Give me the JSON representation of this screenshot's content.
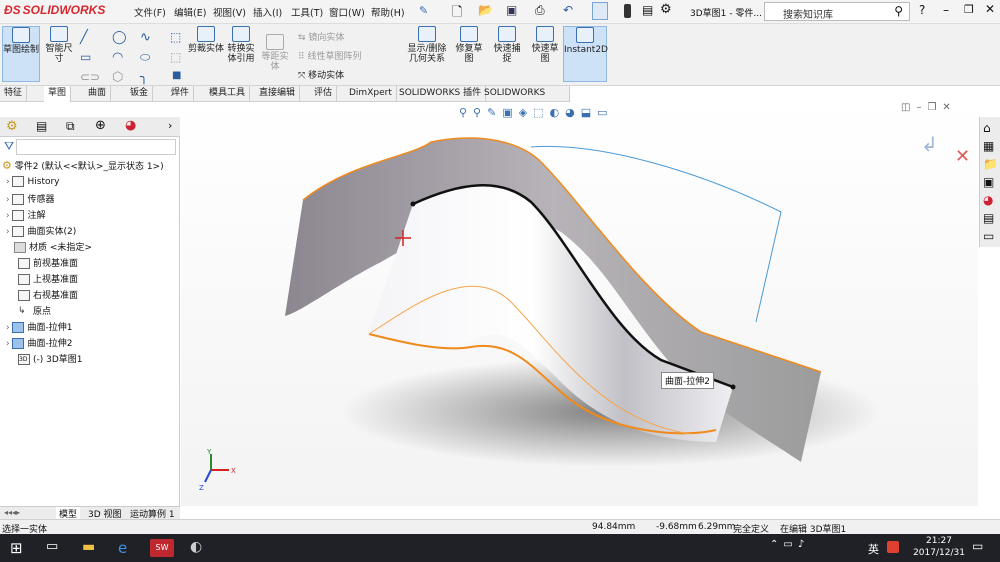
{
  "app": {
    "logo": "SOLIDWORKS",
    "window_title": "3D草图1 - 零件..."
  },
  "menu": [
    "文件(F)",
    "编辑(E)",
    "视图(V)",
    "插入(I)",
    "工具(T)",
    "窗口(W)",
    "帮助(H)"
  ],
  "search": {
    "placeholder": "搜索知识库"
  },
  "commands": {
    "sketch": "草图绘制",
    "smart_dim": "智能尺寸",
    "trim": "剪裁实体",
    "convert": "转换实体引用",
    "offset": "等距实体",
    "mirror": "镜向实体",
    "linear_pattern": "线性草图阵列",
    "move": "移动实体",
    "display_delete": "显示/删除几何关系",
    "repair": "修复草图",
    "quick_snap": "快速捕捉",
    "rapid_sketch": "快速草图",
    "instant2d": "Instant2D"
  },
  "tabs": [
    "特征",
    "草图",
    "曲面",
    "钣金",
    "焊件",
    "模具工具",
    "直接编辑",
    "评估",
    "DimXpert",
    "SOLIDWORKS 插件",
    "SOLIDWORKS MBD"
  ],
  "tree": {
    "root": "零件2 (默认<<默认>_显示状态 1>)",
    "items": [
      "History",
      "传感器",
      "注解",
      "曲面实体(2)",
      "材质 <未指定>",
      "前视基准面",
      "上视基准面",
      "右视基准面",
      "原点",
      "曲面-拉伸1",
      "曲面-拉伸2",
      "(-) 3D草图1"
    ]
  },
  "viewport": {
    "tooltip": "曲面-拉伸2"
  },
  "bottom_tabs": [
    "模型",
    "3D 视图",
    "运动算例 1"
  ],
  "status": {
    "message": "选择一实体",
    "x": "94.84mm",
    "y": "-9.68mm",
    "z": "6.29mm",
    "state": "完全定义",
    "editing": "在编辑 3D草图1"
  },
  "taskbar": {
    "ime": "英",
    "time": "21:27",
    "date": "2017/12/31"
  },
  "colors": {
    "accent": "#d8282f",
    "surface_edge": "#f08a1c",
    "sketch_line": "#111111"
  }
}
